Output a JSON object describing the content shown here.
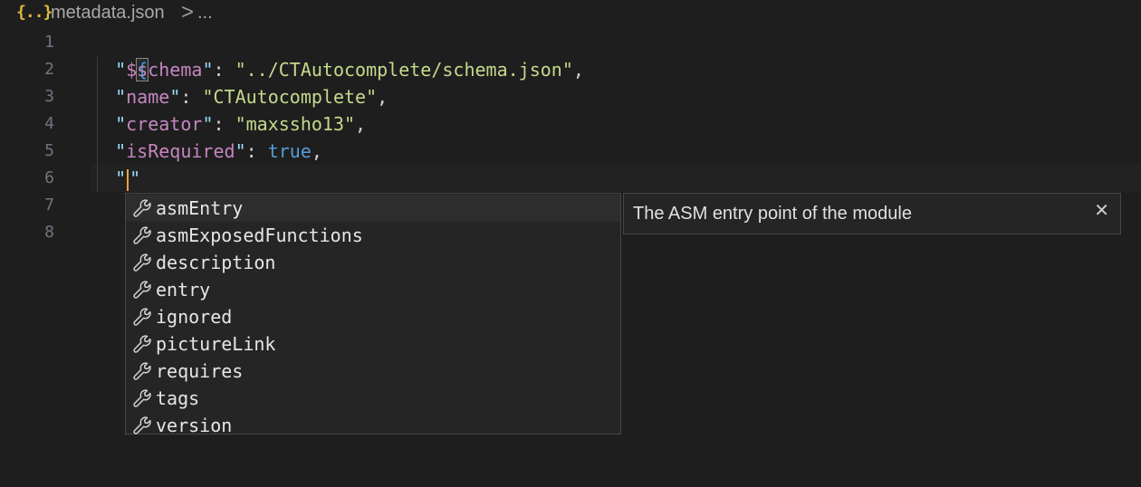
{
  "breadcrumb": {
    "icon": "{..}",
    "icon_name": "json-file-icon",
    "file": "metadata.json",
    "separator": ">",
    "more": "..."
  },
  "gutter": [
    "1",
    "2",
    "3",
    "4",
    "5",
    "6",
    "7",
    "8"
  ],
  "code": {
    "open_brace": "{",
    "close_brace": "}",
    "lines": [
      {
        "key": "$schema",
        "value": "../CTAutocomplete/schema.json",
        "type": "string"
      },
      {
        "key": "name",
        "value": "CTAutocomplete",
        "type": "string"
      },
      {
        "key": "creator",
        "value": "maxssho13",
        "type": "string"
      },
      {
        "key": "isRequired",
        "value": "true",
        "type": "boolean"
      }
    ],
    "typing": "\"\""
  },
  "suggestions": {
    "icon_name": "wrench-icon",
    "items": [
      "asmEntry",
      "asmExposedFunctions",
      "description",
      "entry",
      "ignored",
      "pictureLink",
      "requires",
      "tags",
      "version"
    ],
    "selected_index": 0
  },
  "details": {
    "text": "The ASM entry point of the module",
    "close_icon": "close-icon",
    "close_glyph": "✕"
  },
  "colors": {
    "background": "#1e1e1e",
    "widget_bg": "#252526",
    "brace": "#2f9bd8",
    "key": "#9cdcfe",
    "string": "#c5d98b",
    "keyword": "#569cd6",
    "cursor": "#e8a33c"
  }
}
